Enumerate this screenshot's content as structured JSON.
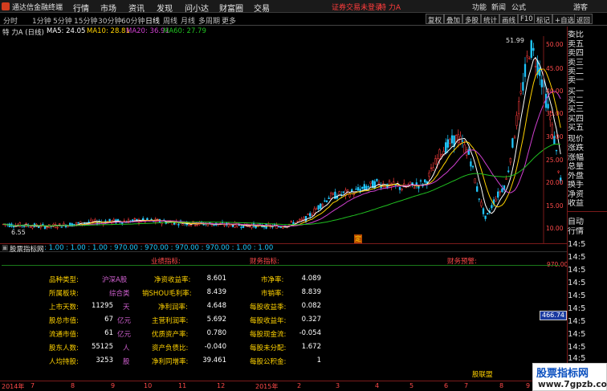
{
  "titlebar": {
    "app": "通达信金融终端",
    "menus": [
      "行情",
      "市场",
      "资讯",
      "发现",
      "问小达",
      "财富圈",
      "交易"
    ],
    "warning": "证券交易未登录",
    "stock": "特 力A",
    "right": [
      "功能",
      "新闻",
      "公式",
      "游客"
    ]
  },
  "periods": [
    "分时",
    "1分钟",
    "5分钟",
    "15分钟",
    "30分钟",
    "60分钟",
    "日线",
    "周线",
    "月线",
    "多周期",
    "更多"
  ],
  "toolbar": [
    "复权",
    "叠加",
    "多股",
    "统计",
    "画线",
    "F10",
    "标记",
    "+自选",
    "返回"
  ],
  "mabar": {
    "name": "特 力A (日线)",
    "ma5": "MA5: 24.05",
    "ma10": "MA10: 28.81",
    "ma20": "MA20: 36.91",
    "ma60": "MA60: 27.79"
  },
  "right_panel": [
    "委比",
    "卖五",
    "卖四",
    "卖三",
    "卖二",
    "卖一",
    "买一",
    "买二",
    "买三",
    "买四",
    "买五",
    "现价",
    "涨跌",
    "涨幅",
    "总量",
    "外盘",
    "换手",
    "净资",
    "收益"
  ],
  "right_panel2": [
    "自动",
    "行情",
    "14:5",
    "14:5",
    "14:5",
    "14:5",
    "14:5",
    "14:5",
    "14:5",
    "14:5",
    "14:5",
    "14:5",
    "14:5"
  ],
  "price_tag": "466.74",
  "yaxis": [
    "50.00",
    "45.00",
    "40.00",
    "35.00",
    "30.00",
    "25.00",
    "20.00",
    "15.00",
    "10.00"
  ],
  "yaxis_ind": [
    "970.00"
  ],
  "annot": {
    "high": "51.99",
    "low": "6.55",
    "mark": "定"
  },
  "indicator": {
    "name": "股票指标网",
    "values": ": 1.00 : 1.00 : 1.00 : 970.00  : 970.00 : 970.00  : 970.00 : 1.00 : 1.00",
    "headers": [
      "业绩指标:",
      "财务指标:",
      "财务预警:"
    ],
    "col1": [
      {
        "label": "品种类型:",
        "value": "沪深A股",
        "unit": ""
      },
      {
        "label": "所属板块:",
        "value": "综合类",
        "unit": ""
      },
      {
        "label": "上市天数:",
        "value": "11295",
        "unit": "天"
      },
      {
        "label": "股总市值:",
        "value": "67",
        "unit": "亿元"
      },
      {
        "label": "流通市值:",
        "value": "61",
        "unit": "亿元"
      },
      {
        "label": "股东人数:",
        "value": "55125",
        "unit": "人"
      },
      {
        "label": "人均持股:",
        "value": "3253",
        "unit": "股"
      }
    ],
    "col2": [
      {
        "label": "净资收益率:",
        "value": "8.601"
      },
      {
        "label": "销SHOU毛利率:",
        "value": "8.439"
      },
      {
        "label": "净利润率:",
        "value": "4.648"
      },
      {
        "label": "主营利润率:",
        "value": "5.692"
      },
      {
        "label": "优质资产率:",
        "value": "0.780"
      },
      {
        "label": "资产负债比:",
        "value": "-0.040"
      },
      {
        "label": "净利同增率:",
        "value": "39.461"
      }
    ],
    "col3": [
      {
        "label": "市净率:",
        "value": "4.089"
      },
      {
        "label": "市销率:",
        "value": "8.839"
      },
      {
        "label": "每股收益季:",
        "value": "0.082"
      },
      {
        "label": "每股收益年:",
        "value": "0.327"
      },
      {
        "label": "每股现金流:",
        "value": "-0.054"
      },
      {
        "label": "每股未分配:",
        "value": "1.672"
      },
      {
        "label": "每股公积金:",
        "value": "1"
      }
    ],
    "alliance": "股联盟"
  },
  "dateaxis": [
    "2014年",
    "7",
    "8",
    "9",
    "10",
    "11",
    "12",
    "2015年",
    "2",
    "3",
    "4",
    "5",
    "6",
    "7",
    "8",
    "9",
    "10"
  ],
  "watermark": {
    "title": "股票指标网",
    "url": "www.7gpzb.com"
  },
  "colors": {
    "ma5": "#ffffff",
    "ma10": "#ffd200",
    "ma20": "#d040d0",
    "ma60": "#20c020",
    "up": "#ff3c3c",
    "down": "#20c8ff"
  }
}
